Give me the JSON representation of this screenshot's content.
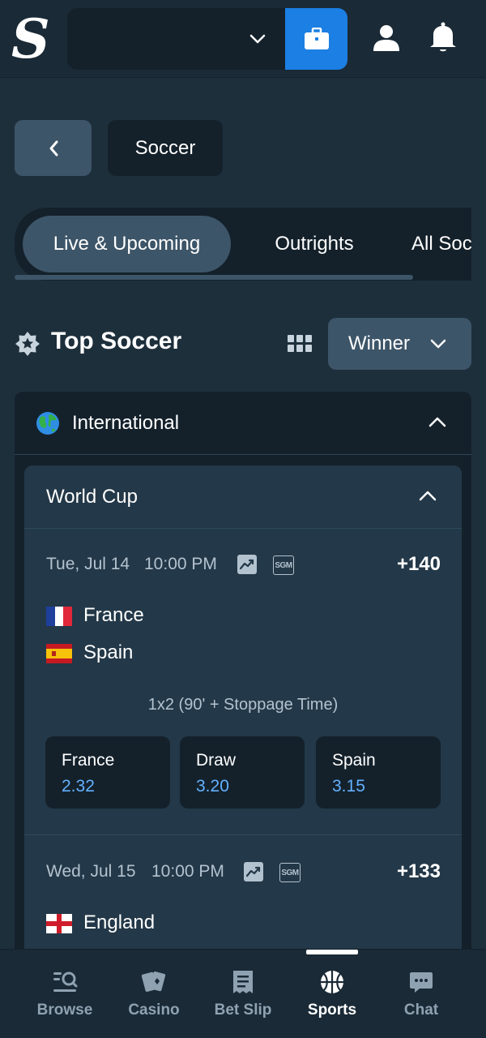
{
  "header": {
    "logo_letter": "S",
    "account_selector_value": "",
    "icons": [
      "chevron-down-icon",
      "wallet-icon",
      "user-icon",
      "bell-icon"
    ]
  },
  "nav": {
    "back_label": "",
    "sport_title": "Soccer"
  },
  "tabs": [
    {
      "label": "Live & Upcoming",
      "active": true
    },
    {
      "label": "Outrights",
      "active": false
    },
    {
      "label": "All Soccer",
      "active": false
    }
  ],
  "section": {
    "title": "Top Soccer",
    "market_select": "Winner"
  },
  "region": {
    "name": "International",
    "competition": {
      "name": "World Cup",
      "events": [
        {
          "date": "Tue, Jul 14",
          "time": "10:00 PM",
          "more_markets": "+140",
          "home": "France",
          "away": "Spain",
          "market_label": "1x2 (90' + Stoppage Time)",
          "outcomes": [
            {
              "label": "France",
              "price": "2.32"
            },
            {
              "label": "Draw",
              "price": "3.20"
            },
            {
              "label": "Spain",
              "price": "3.15"
            }
          ]
        },
        {
          "date": "Wed, Jul 15",
          "time": "10:00 PM",
          "more_markets": "+133",
          "home": "England"
        }
      ]
    }
  },
  "sgm_badge": "SGM",
  "bottom_nav": [
    {
      "label": "Browse",
      "icon": "browse-icon"
    },
    {
      "label": "Casino",
      "icon": "cards-icon"
    },
    {
      "label": "Bet Slip",
      "icon": "betslip-icon"
    },
    {
      "label": "Sports",
      "icon": "basketball-icon",
      "active": true
    },
    {
      "label": "Chat",
      "icon": "chat-icon"
    }
  ],
  "colors": {
    "background": "#1e2f3c",
    "accent": "#1b7fe3",
    "odds": "#63b1ff"
  }
}
